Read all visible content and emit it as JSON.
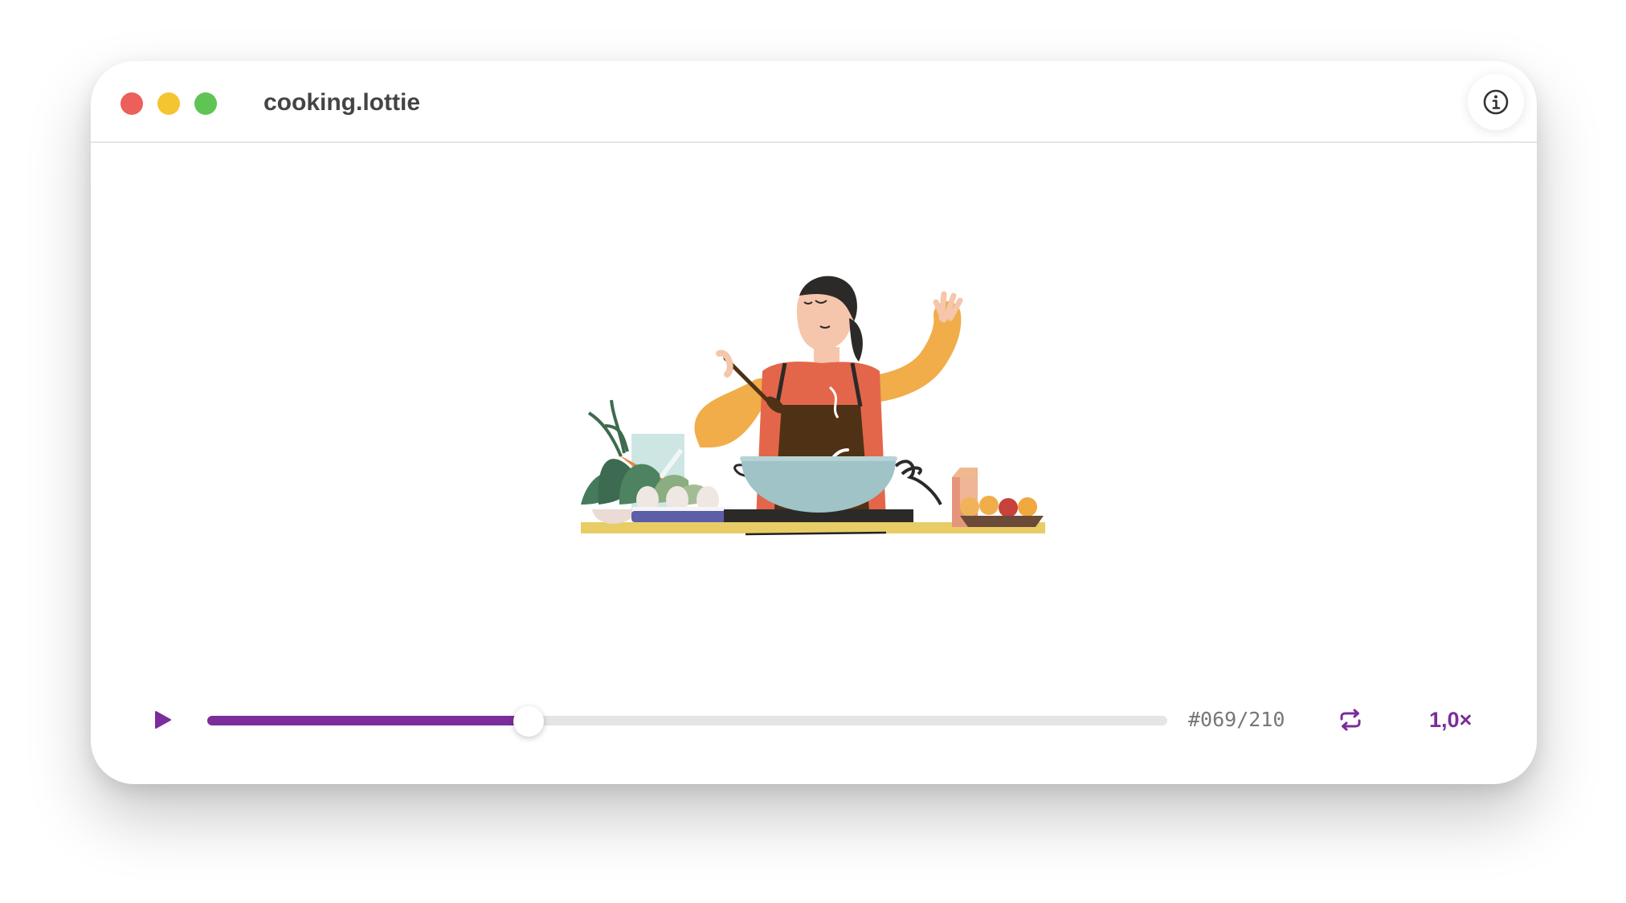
{
  "window": {
    "title": "cooking.lottie"
  },
  "player": {
    "progress_fraction": 0.335,
    "frame_counter": "#069/210",
    "speed_label": "1,0×"
  },
  "icons": {
    "info": "info-circle-icon",
    "play": "play-icon",
    "loop": "loop-icon"
  },
  "colors": {
    "accent": "#7b2d9b",
    "close": "#ec5f5a",
    "minimize": "#f5c431",
    "zoom": "#5fc454"
  }
}
